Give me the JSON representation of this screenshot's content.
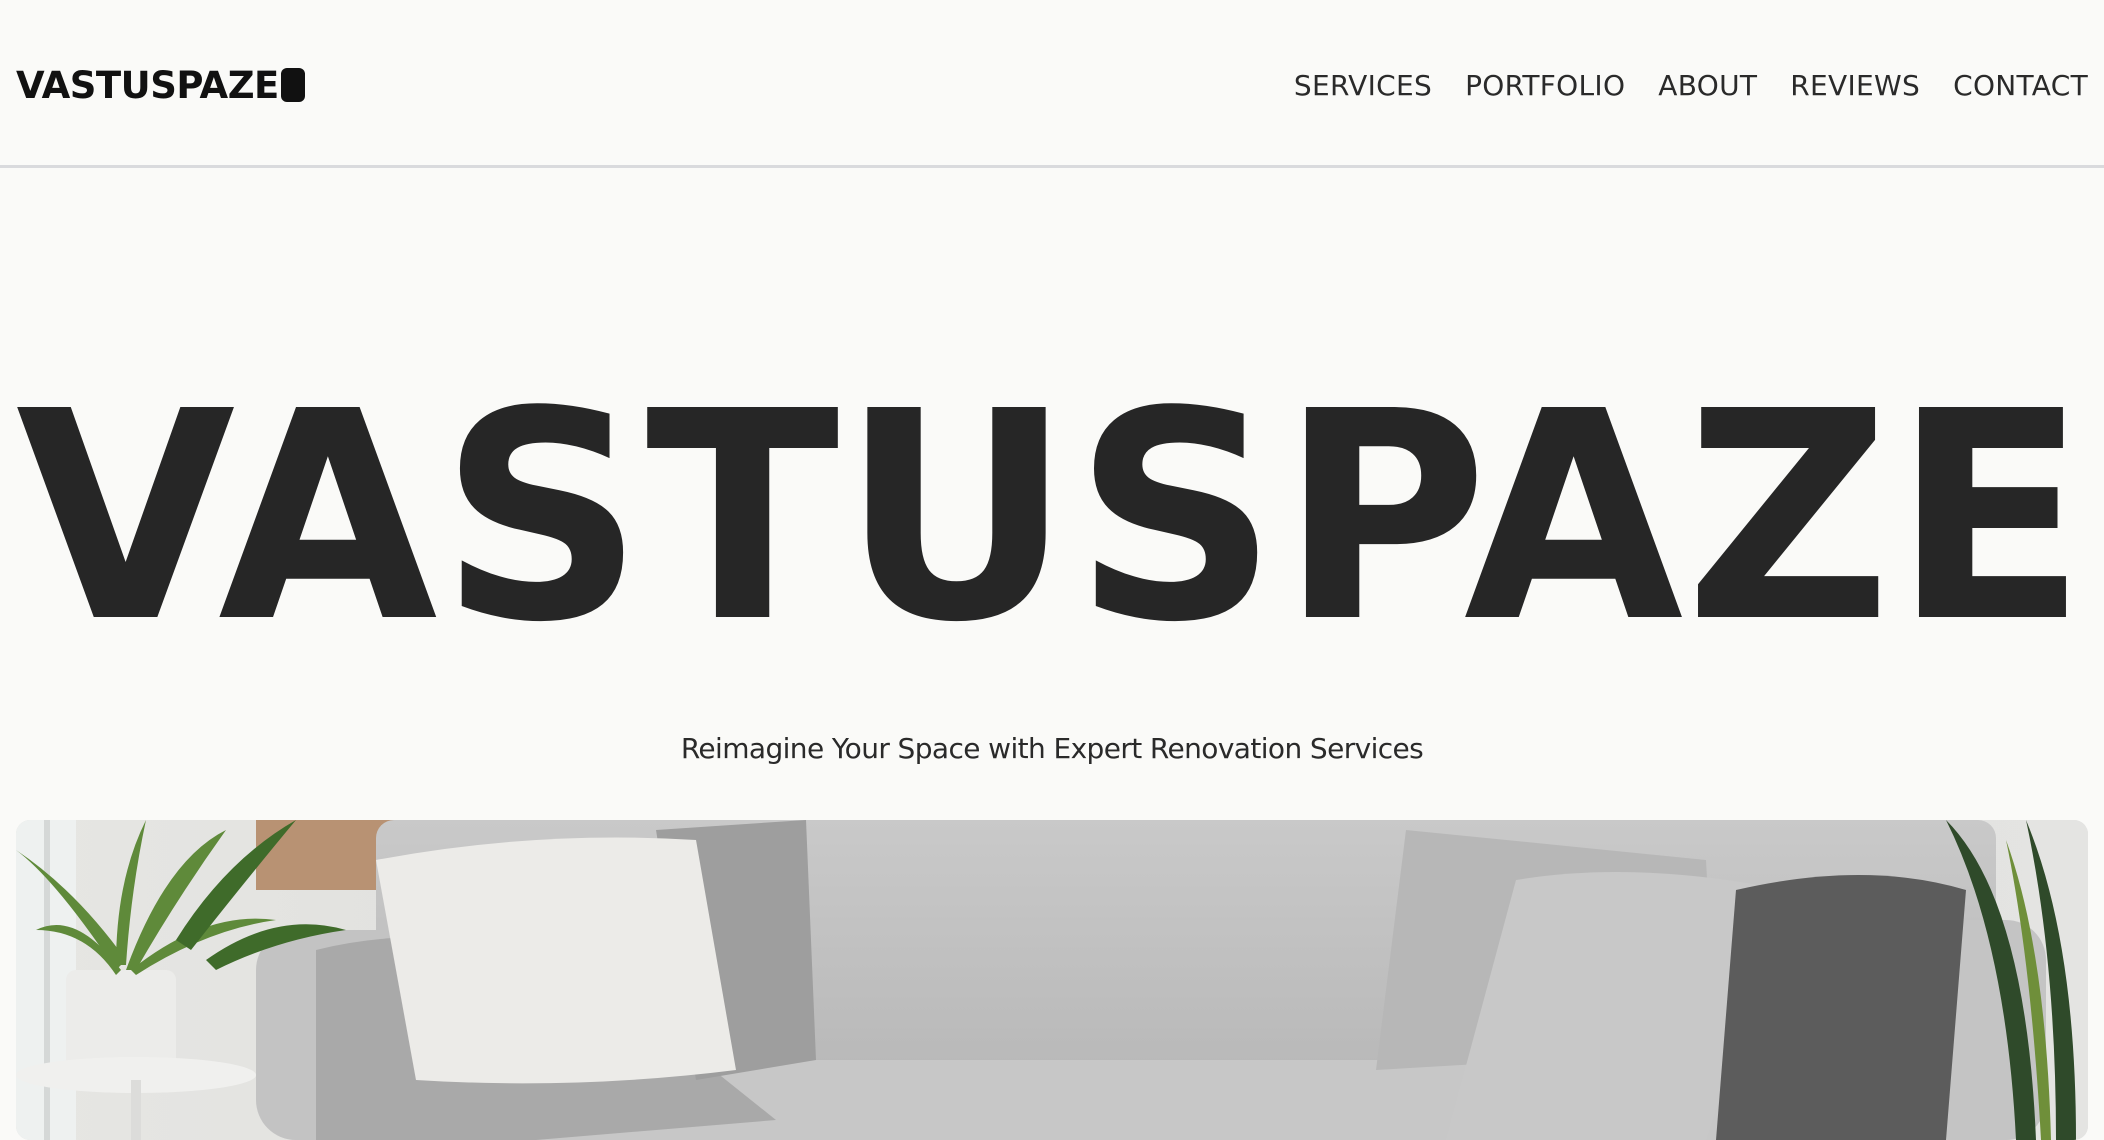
{
  "brand": {
    "logo_text": "VASTUSPAZE"
  },
  "nav": {
    "items": [
      {
        "label": "SERVICES"
      },
      {
        "label": "PORTFOLIO"
      },
      {
        "label": "ABOUT"
      },
      {
        "label": "REVIEWS"
      },
      {
        "label": "CONTACT"
      }
    ]
  },
  "hero": {
    "title": "VASTUSPAZE",
    "subtitle": "Reimagine Your Space with Expert Renovation Services"
  },
  "colors": {
    "background": "#fafaf8",
    "text": "#262626",
    "divider": "#d9dadd"
  }
}
